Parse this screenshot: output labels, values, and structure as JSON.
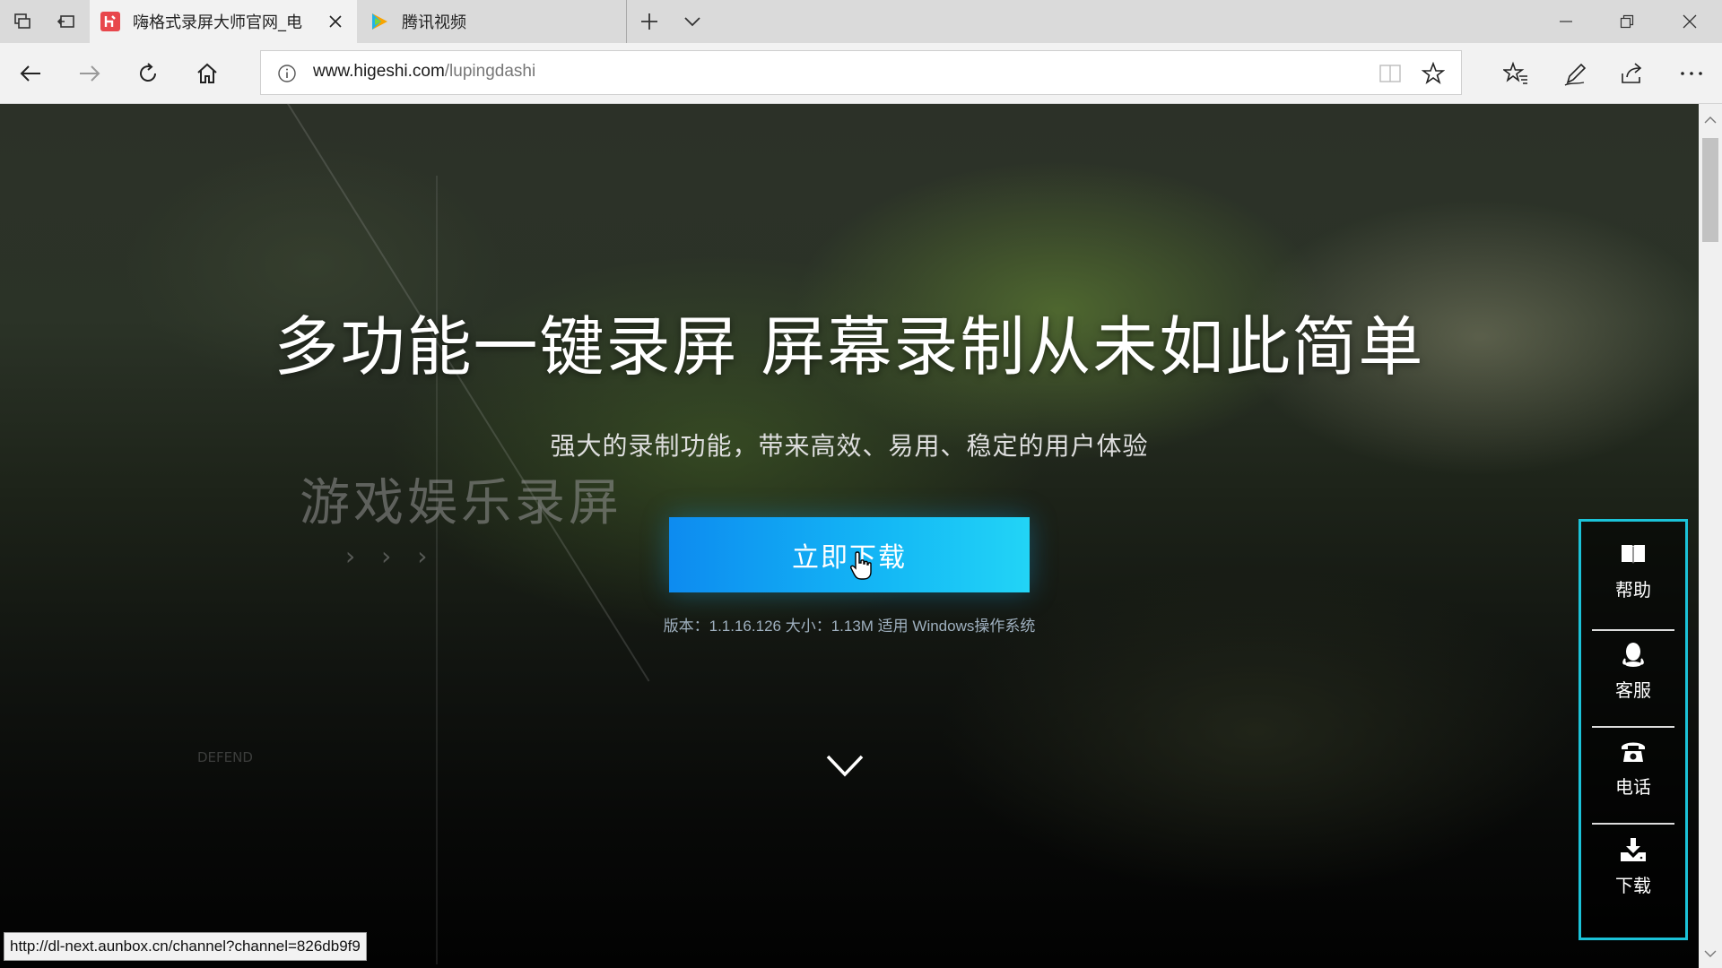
{
  "browser": {
    "tabs": [
      {
        "title": "嗨格式录屏大师官网_电",
        "active": true,
        "favicon": "higeshi-logo-icon",
        "favicon_color": "#e8474c"
      },
      {
        "title": "腾讯视频",
        "active": false,
        "favicon": "tencent-video-icon"
      }
    ],
    "address": {
      "host": "www.higeshi.com",
      "path": "/lupingdashi"
    },
    "status_url": "http://dl-next.aunbox.cn/channel?channel=826db9f9"
  },
  "page": {
    "headline": "多功能一键录屏 屏幕录制从未如此简单",
    "subheadline": "强大的录制功能，带来高效、易用、稳定的用户体验",
    "background_text": "游戏娱乐录屏",
    "background_arrows": "› › ›",
    "background_defend": "DEFEND",
    "download_button": "立即下载",
    "version_info": "版本：1.1.16.126 大小：1.13M 适用 Windows操作系统",
    "accent_color": "#1bc2d8",
    "button_color": "#14b8f5"
  },
  "side_panel": {
    "items": [
      {
        "label": "帮助",
        "icon": "book-icon"
      },
      {
        "label": "客服",
        "icon": "qq-penguin-icon"
      },
      {
        "label": "电话",
        "icon": "phone-icon"
      },
      {
        "label": "下载",
        "icon": "download-icon"
      }
    ]
  }
}
